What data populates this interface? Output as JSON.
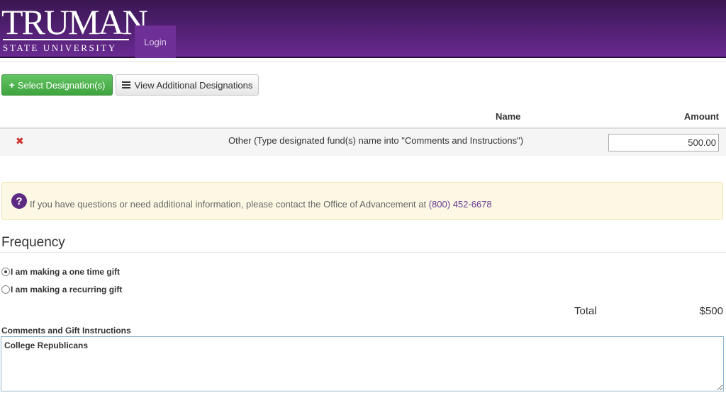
{
  "header": {
    "logo_word": "TRUMAN",
    "logo_sub": "STATE UNIVERSITY",
    "login_label": "Login"
  },
  "actions": {
    "select_label": "Select Designation(s)",
    "view_label": "View Additional Designations"
  },
  "table": {
    "headers": {
      "name": "Name",
      "amount": "Amount"
    },
    "rows": [
      {
        "remove": "✖",
        "name": "Other (Type designated fund(s) name into \"Comments and Instructions\")",
        "amount": "500.00"
      }
    ]
  },
  "alert": {
    "icon": "?",
    "text": "If you have questions or need additional information, please contact the Office of Advancement at ",
    "phone": "(800) 452-6678"
  },
  "frequency": {
    "title": "Frequency",
    "options": [
      {
        "label": "I am making a one time gift",
        "checked": true
      },
      {
        "label": "I am making a recurring gift",
        "checked": false
      }
    ]
  },
  "total": {
    "label": "Total",
    "value": "$500"
  },
  "comments": {
    "label": "Comments and Gift Instructions",
    "value": "College Republicans"
  },
  "colors": {
    "header_purple": "#4e1f6e",
    "login_tab": "#6e2f97",
    "select_green": "#4cae4c",
    "remove_red": "#c9302c",
    "alert_bg": "#fcf8e3",
    "link_purple": "#6a3a95"
  },
  "icons": {
    "plus": "plus-icon",
    "list": "list-icon",
    "remove": "remove-x-icon",
    "question": "question-circle-icon"
  }
}
